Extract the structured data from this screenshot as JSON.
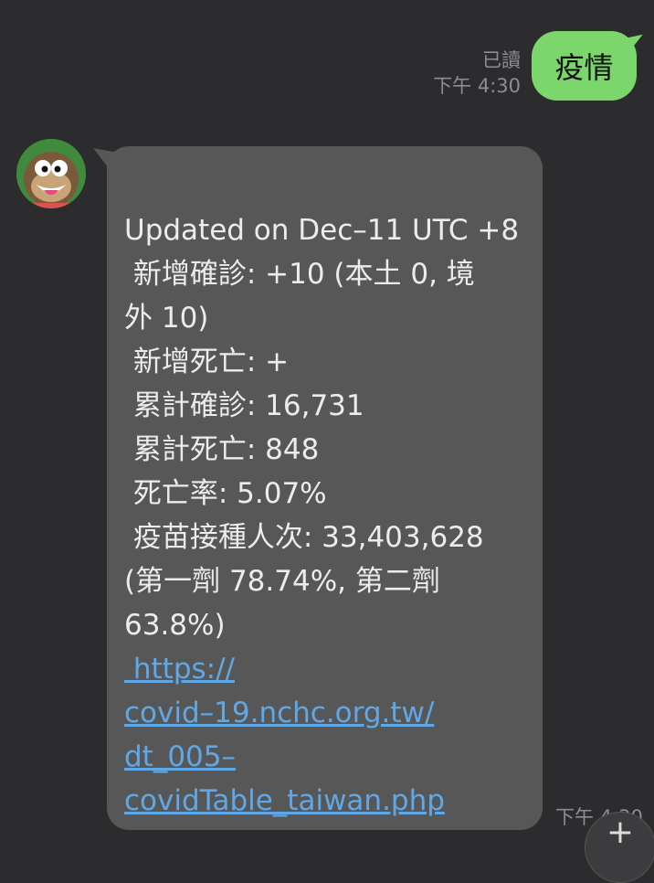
{
  "sent": {
    "text": "疫情",
    "read_label": "已讀",
    "time": "下午 4:30"
  },
  "received": {
    "lines": [
      "Updated on Dec–11 UTC +8",
      " 新增確診: +10 (本土 0, 境",
      "外 10)",
      " 新增死亡: +",
      " 累計確診: 16,731",
      " 累計死亡: 848",
      " 死亡率: 5.07%",
      " 疫苗接種人次: 33,403,628",
      "(第一劑 78.74%, 第二劑",
      "63.8%)"
    ],
    "link_lines": [
      "https://",
      "covid–19.nchc.org.tw/",
      "dt_005–",
      "covidTable_taiwan.php"
    ],
    "time": "下午 4:30"
  },
  "colors": {
    "background": "#2c2c2e",
    "sent_bubble": "#7bd66c",
    "received_bubble": "#575757",
    "link": "#5fa8e8"
  },
  "icons": {
    "avatar": "monkey-avatar-icon",
    "scroll_down": "arrow-down-icon"
  }
}
